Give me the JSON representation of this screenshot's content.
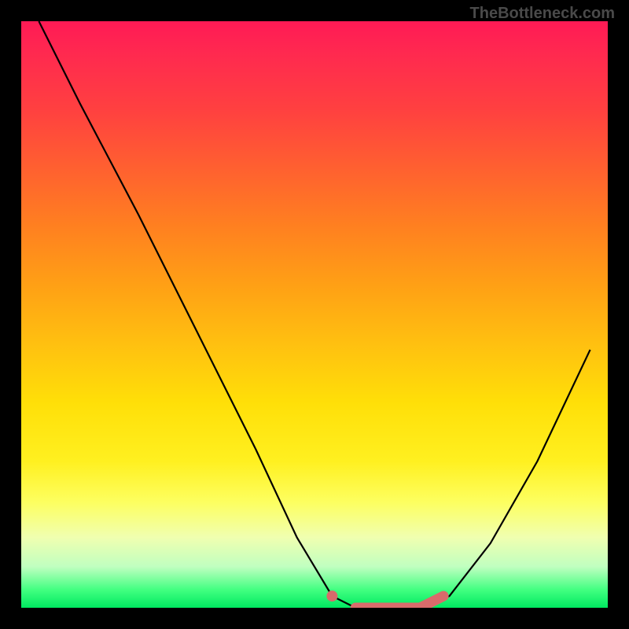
{
  "watermark": "TheBottleneck.com",
  "chart_data": {
    "type": "line",
    "title": "",
    "xlabel": "",
    "ylabel": "",
    "xlim": [
      0,
      100
    ],
    "ylim": [
      0,
      100
    ],
    "series": [
      {
        "name": "bottleneck-curve",
        "x": [
          3,
          10,
          20,
          30,
          40,
          47,
          53,
          57,
          62,
          68,
          73,
          80,
          88,
          97
        ],
        "values": [
          100,
          86,
          67,
          47,
          27,
          12,
          2,
          0,
          0,
          0,
          2,
          11,
          25,
          44
        ]
      }
    ],
    "highlight": {
      "name": "optimal-range",
      "x": [
        53,
        57,
        62,
        68,
        72
      ],
      "values": [
        2,
        0,
        0,
        0,
        2
      ],
      "color": "#d96b6b"
    },
    "gradient_colors": {
      "top": "#ff1a55",
      "mid": "#ffdf08",
      "bottom": "#00e860"
    }
  }
}
